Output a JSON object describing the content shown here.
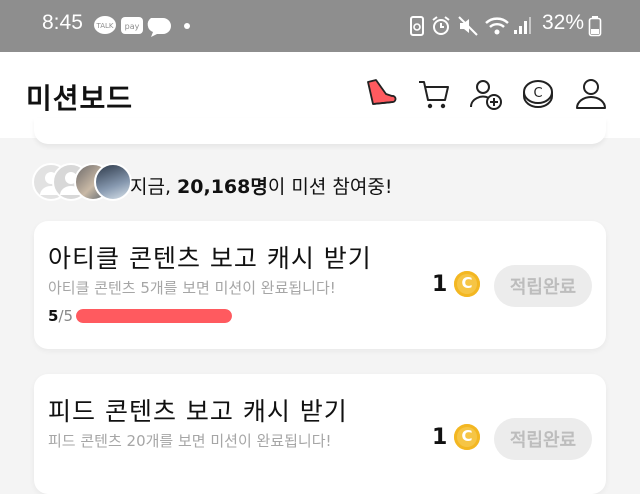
{
  "status_bar": {
    "time": "8:45",
    "notif_icons": [
      "talk-icon",
      "pay-icon",
      "chat-bubble-icon",
      "dot-icon"
    ],
    "system_icons": [
      "recycle-icon",
      "alarm-icon",
      "mute-icon",
      "wifi-icon",
      "signal-icon"
    ],
    "battery": "32%"
  },
  "header": {
    "title": "미션보드",
    "icons": [
      "shoe-icon",
      "cart-icon",
      "add-friend-icon",
      "coin-icon",
      "profile-icon"
    ]
  },
  "participants": {
    "prefix": "지금, ",
    "count": "20,168명",
    "suffix": "이 미션 참여중!"
  },
  "missions": [
    {
      "title": "아티클 콘텐츠 보고 캐시 받기",
      "desc": "아티클 콘텐츠 5개를 보면 미션이 완료됩니다!",
      "progress_current": "5",
      "progress_total": "/5",
      "progress_fraction": 1.0,
      "reward": "1",
      "coin_symbol": "C",
      "button": "적립완료"
    },
    {
      "title": "피드 콘텐츠 보고 캐시 받기",
      "desc": "피드 콘텐츠 20개를 보면 미션이 완료됩니다!",
      "reward": "1",
      "coin_symbol": "C",
      "button": "적립완료"
    }
  ],
  "colors": {
    "accent": "#ff5a5f",
    "coin": "#f6c545",
    "status_bar": "#8e8e8e"
  }
}
